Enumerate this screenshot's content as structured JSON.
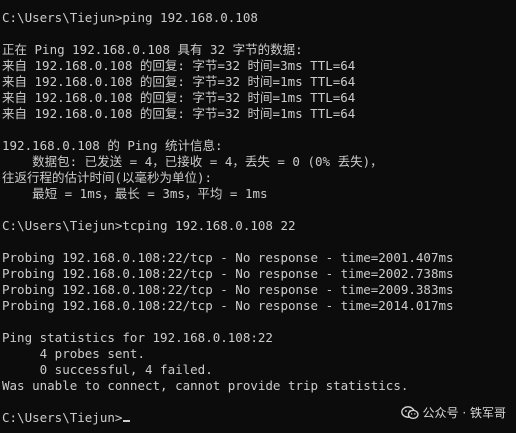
{
  "colors": {
    "background": "#0c0c0c",
    "text": "#cccccc"
  },
  "terminal": {
    "lines": [
      "C:\\Users\\Tiejun>ping 192.168.0.108",
      "",
      "正在 Ping 192.168.0.108 具有 32 字节的数据:",
      "来自 192.168.0.108 的回复: 字节=32 时间=3ms TTL=64",
      "来自 192.168.0.108 的回复: 字节=32 时间=1ms TTL=64",
      "来自 192.168.0.108 的回复: 字节=32 时间=1ms TTL=64",
      "来自 192.168.0.108 的回复: 字节=32 时间=1ms TTL=64",
      "",
      "192.168.0.108 的 Ping 统计信息:",
      "    数据包: 已发送 = 4，已接收 = 4，丢失 = 0 (0% 丢失)，",
      "往返行程的估计时间(以毫秒为单位):",
      "    最短 = 1ms，最长 = 3ms，平均 = 1ms",
      "",
      "C:\\Users\\Tiejun>tcping 192.168.0.108 22",
      "",
      "Probing 192.168.0.108:22/tcp - No response - time=2001.407ms",
      "Probing 192.168.0.108:22/tcp - No response - time=2002.738ms",
      "Probing 192.168.0.108:22/tcp - No response - time=2009.383ms",
      "Probing 192.168.0.108:22/tcp - No response - time=2014.017ms",
      "",
      "Ping statistics for 192.168.0.108:22",
      "     4 probes sent.",
      "     0 successful, 4 failed.",
      "Was unable to connect, cannot provide trip statistics.",
      "",
      "C:\\Users\\Tiejun>"
    ]
  },
  "watermark": {
    "icon": "wechat-official-account-icon",
    "text": "公众号 · 铁军哥"
  }
}
